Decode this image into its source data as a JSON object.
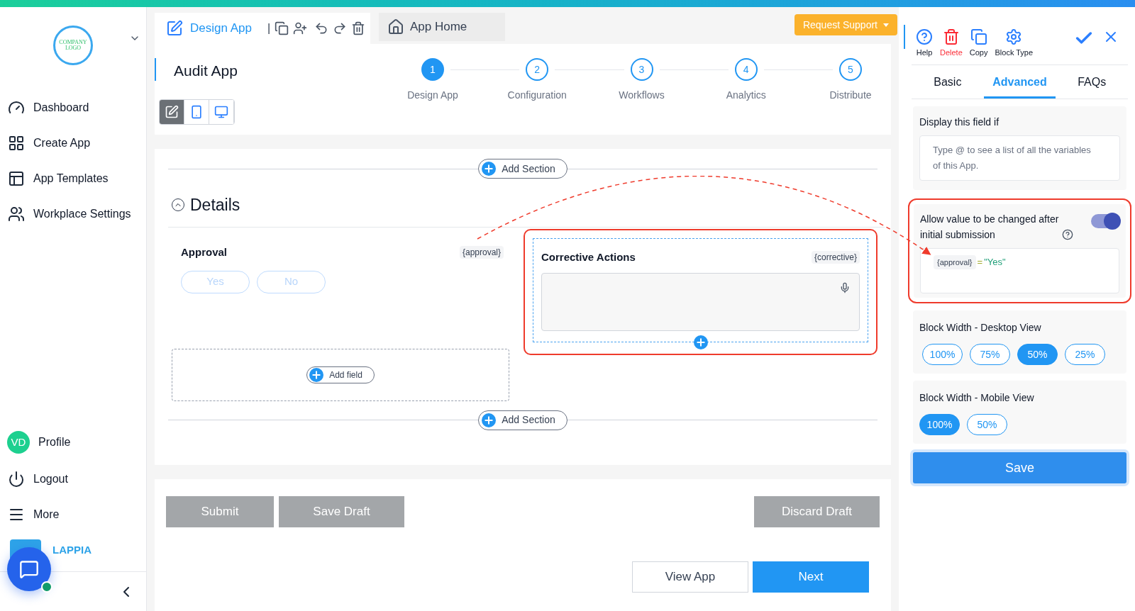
{
  "sidebar": {
    "logo_text": "COMPANY LOGO",
    "items": [
      {
        "label": "Dashboard",
        "kind": "gauge"
      },
      {
        "label": "Create App",
        "kind": "grid"
      },
      {
        "label": "App Templates",
        "kind": "layout"
      },
      {
        "label": "Workplace Settings",
        "kind": "people"
      }
    ],
    "profile": {
      "initials": "VD",
      "label": "Profile"
    },
    "footer_items": [
      {
        "label": "Logout",
        "kind": "power"
      },
      {
        "label": "More",
        "kind": "menu"
      }
    ],
    "brand": "LAPPIA"
  },
  "toolbar": {
    "design_tab": "Design App",
    "separator": "|",
    "home_tab": "App Home",
    "request_support": "Request Support"
  },
  "app_title": "Audit App",
  "steps": [
    {
      "number": "1",
      "label": "Design App",
      "selected": true
    },
    {
      "number": "2",
      "label": "Configuration",
      "selected": false
    },
    {
      "number": "3",
      "label": "Workflows",
      "selected": false
    },
    {
      "number": "4",
      "label": "Analytics",
      "selected": false
    },
    {
      "number": "5",
      "label": "Distribute",
      "selected": false
    }
  ],
  "view_modes": [
    {
      "kind": "edit",
      "selected": true
    },
    {
      "kind": "mobile",
      "selected": false
    },
    {
      "kind": "desktop",
      "selected": false
    }
  ],
  "form": {
    "add_section_top": "Add Section",
    "section_title": "Details",
    "approval": {
      "label": "Approval",
      "variable": "{approval}",
      "options": [
        "Yes",
        "No"
      ]
    },
    "corrective": {
      "label": "Corrective Actions",
      "variable": "{corrective}"
    },
    "add_field": "Add field",
    "add_section_bottom": "Add Section"
  },
  "actions": [
    "Submit",
    "Save Draft",
    "Discard Draft"
  ],
  "navigation": [
    "View App",
    "Next"
  ],
  "panel": {
    "tools": [
      {
        "label": "Help",
        "kind": "help"
      },
      {
        "label": "Delete",
        "kind": "delete"
      },
      {
        "label": "Copy",
        "kind": "copy"
      },
      {
        "label": "Block Type",
        "kind": "gear"
      }
    ],
    "tabs": [
      {
        "label": "Basic",
        "selected": false
      },
      {
        "label": "Advanced",
        "selected": true
      },
      {
        "label": "FAQs",
        "selected": false
      }
    ],
    "display_if": {
      "label": "Display this field if",
      "placeholder": "Type @ to see a list of all the variables of this App."
    },
    "allow_change": {
      "label": "Allow value to be changed after initial submission",
      "on": true,
      "condition_variable": "{approval}",
      "condition_operator": "=",
      "condition_value": "\"Yes\""
    },
    "desktop_width": {
      "label": "Block Width - Desktop View",
      "options": [
        {
          "label": "100%",
          "selected": false
        },
        {
          "label": "75%",
          "selected": false
        },
        {
          "label": "50%",
          "selected": true
        },
        {
          "label": "25%",
          "selected": false
        }
      ]
    },
    "mobile_width": {
      "label": "Block Width - Mobile View",
      "options": [
        {
          "label": "100%",
          "selected": true
        },
        {
          "label": "50%",
          "selected": false
        }
      ]
    },
    "save": "Save"
  }
}
